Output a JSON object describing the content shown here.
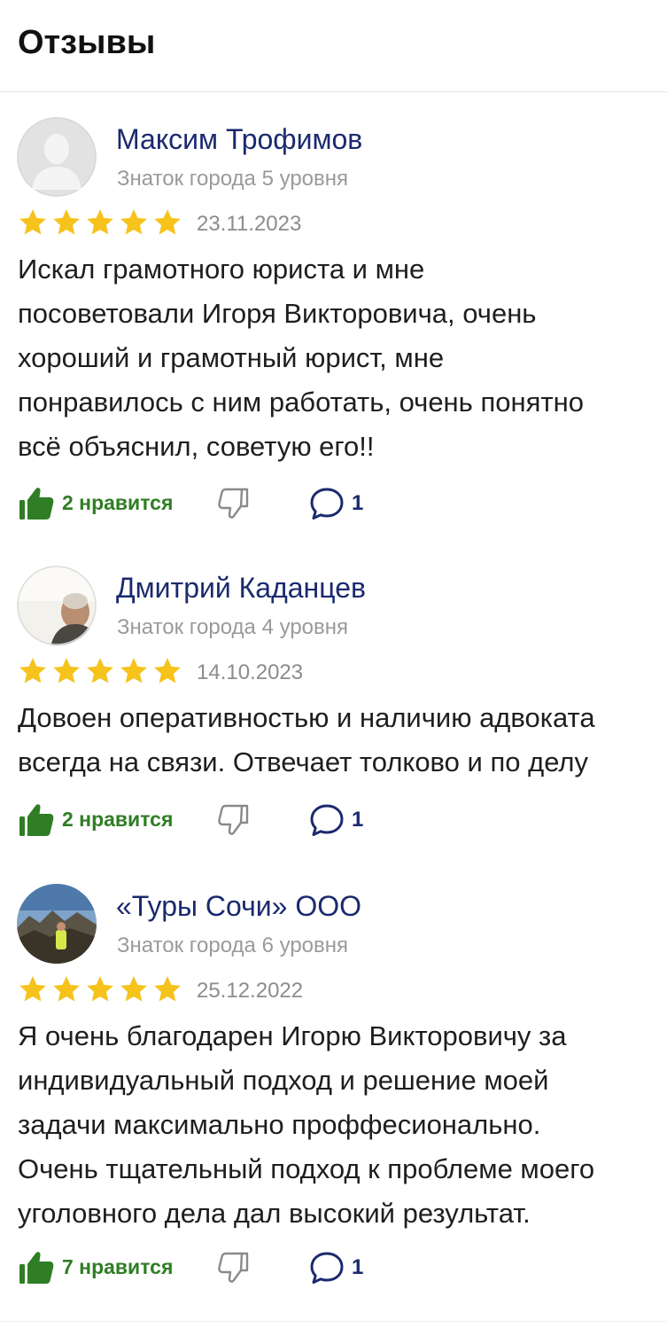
{
  "header": {
    "title": "Отзывы"
  },
  "colors": {
    "star": "#f6c21c",
    "like": "#2f7d24",
    "author": "#1a2a6e"
  },
  "reviews": [
    {
      "author": "Максим Трофимов",
      "level": "Знаток города 5 уровня",
      "rating": 5,
      "date": "23.11.2023",
      "text": "Искал грамотного юриста и мне\nпосоветовали Игоря Викторовича, очень\nхороший и грамотный юрист, мне\nпонравилось с ним работать, очень понятно\nвсё объяснил, советую его!!",
      "likes_label": "2 нравится",
      "comments": "1",
      "avatar": "placeholder-person"
    },
    {
      "author": "Дмитрий Каданцев",
      "level": "Знаток города 4 уровня",
      "rating": 5,
      "date": "14.10.2023",
      "text": "Довоен оперативностью и наличию адвоката\nвсегда на связи. Отвечает толково и по делу",
      "likes_label": "2 нравится",
      "comments": "1",
      "avatar": "photo-man"
    },
    {
      "author": "«Туры Сочи» ООО",
      "level": "Знаток города 6 уровня",
      "rating": 5,
      "date": "25.12.2022",
      "text": "Я очень благодарен Игорю Викторовичу за\nиндивидуальный подход и решение моей\nзадачи максимально проффесионально.\nОчень тщательный подход к проблеме моего\nуголовного дела дал высокий результат.",
      "likes_label": "7 нравится",
      "comments": "1",
      "avatar": "photo-mountains"
    }
  ]
}
